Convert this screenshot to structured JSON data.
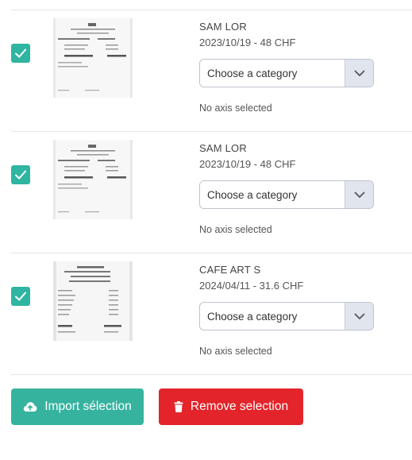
{
  "receipts": [
    {
      "merchant": "SAM LOR",
      "date_amount": "2023/10/19 - 48 CHF",
      "category_placeholder": "Choose a category",
      "axis_status": "No axis selected",
      "checked": true
    },
    {
      "merchant": "SAM LOR",
      "date_amount": "2023/10/19 - 48 CHF",
      "category_placeholder": "Choose a category",
      "axis_status": "No axis selected",
      "checked": true
    },
    {
      "merchant": "CAFE ART S",
      "date_amount": "2024/04/11 - 31.6 CHF",
      "category_placeholder": "Choose a category",
      "axis_status": "No axis selected",
      "checked": true
    }
  ],
  "actions": {
    "import_label": "Import sélection",
    "remove_label": "Remove selection"
  },
  "colors": {
    "accent": "#2fb5a1",
    "import_button": "#36b39f",
    "remove_button": "#e3242a"
  },
  "icons": {
    "checkbox": "checkmark-icon",
    "select": "chevron-down-icon",
    "import": "cloud-upload-icon",
    "remove": "trash-icon"
  }
}
